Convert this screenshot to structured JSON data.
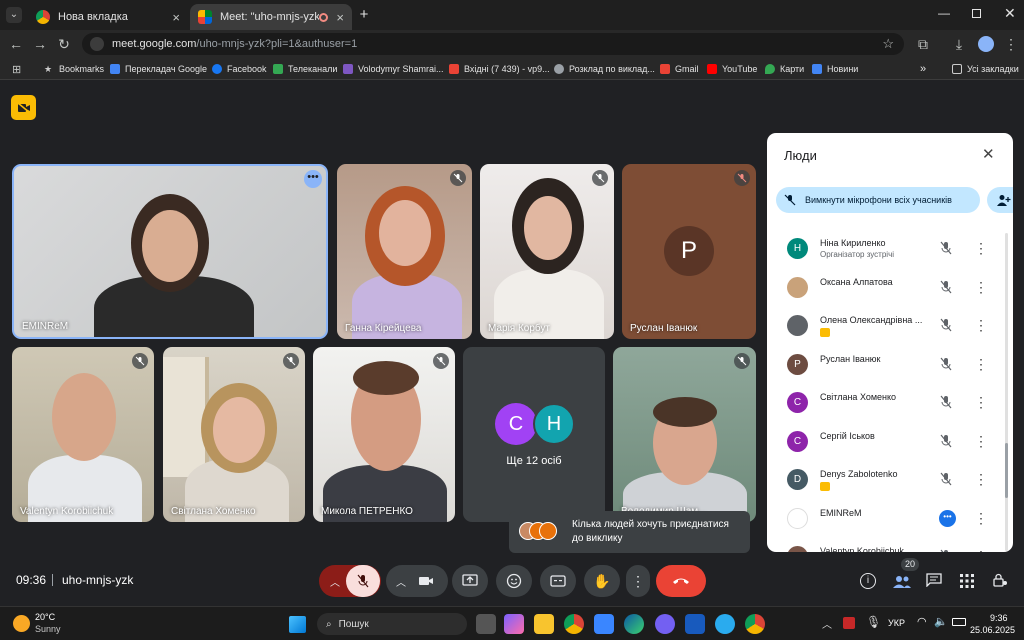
{
  "tabs": [
    {
      "title": "Нова вкладка"
    },
    {
      "title": "Meet: \"uho-mnjs-yzk\""
    }
  ],
  "address": {
    "host": "meet.google.com",
    "path": "/uho-mnjs-yzk?pli=1&authuser=1"
  },
  "bookmarks": [
    "Bookmarks",
    "Перекладач Google",
    "Facebook",
    "Телеканали",
    "Volodymyr Shamrai...",
    "Вхідні (7 439) - vp9...",
    "Розклад по виклад...",
    "Gmail",
    "YouTube",
    "Карти",
    "Новини",
    "Усі закладки"
  ],
  "tiles": {
    "t1": "EMINReM",
    "t2": "Ганна Кірейцева",
    "t3": "Марія Корбут",
    "t4": "Руслан Іванюк",
    "t4_initial": "P",
    "t5": "Valentyn Korobiichuk",
    "t6": "Світлана Хоменко",
    "t7": "Микола ПЕТРЕНКО",
    "t8": "Ще 12 осіб",
    "t8_a": "С",
    "t8_b": "Н",
    "t9": "Володимир Шам..."
  },
  "toast": "Кілька людей хочуть приєднатися до виклику",
  "bottom": {
    "time": "09:36",
    "code": "uho-mnjs-yzk",
    "people_count": "20"
  },
  "panel": {
    "title": "Люди",
    "mute_all": "Вимкнути мікрофони всіх учасників",
    "people": [
      {
        "initial": "Н",
        "name": "Ніна Кириленко",
        "sub": "Організатор зустрічі",
        "color": "#00897b"
      },
      {
        "initial": "",
        "name": "Оксана Алпатова",
        "sub": "",
        "color": "#c9a27a"
      },
      {
        "initial": "",
        "name": "Олена Олександрівна ...",
        "sub": "",
        "color": "#5f6368"
      },
      {
        "initial": "Р",
        "name": "Руслан Іванюк",
        "sub": "",
        "color": "#6d4c41"
      },
      {
        "initial": "С",
        "name": "Світлана Хоменко",
        "sub": "",
        "color": "#8e24aa"
      },
      {
        "initial": "С",
        "name": "Сергій Іськов",
        "sub": "",
        "color": "#8e24aa"
      },
      {
        "initial": "D",
        "name": "Denys Zabolotenko",
        "sub": "",
        "color": "#455a64"
      },
      {
        "initial": "",
        "name": "EMINReM",
        "sub": "",
        "color": "#ffffff"
      },
      {
        "initial": "",
        "name": "Valentyn Korobiichuk",
        "sub": "",
        "color": "#795548"
      }
    ]
  },
  "taskbar": {
    "temp": "20°C",
    "weather": "Sunny",
    "search": "Пошук",
    "lang": "УКР",
    "clock": "9:36",
    "date": "25.06.2025"
  }
}
